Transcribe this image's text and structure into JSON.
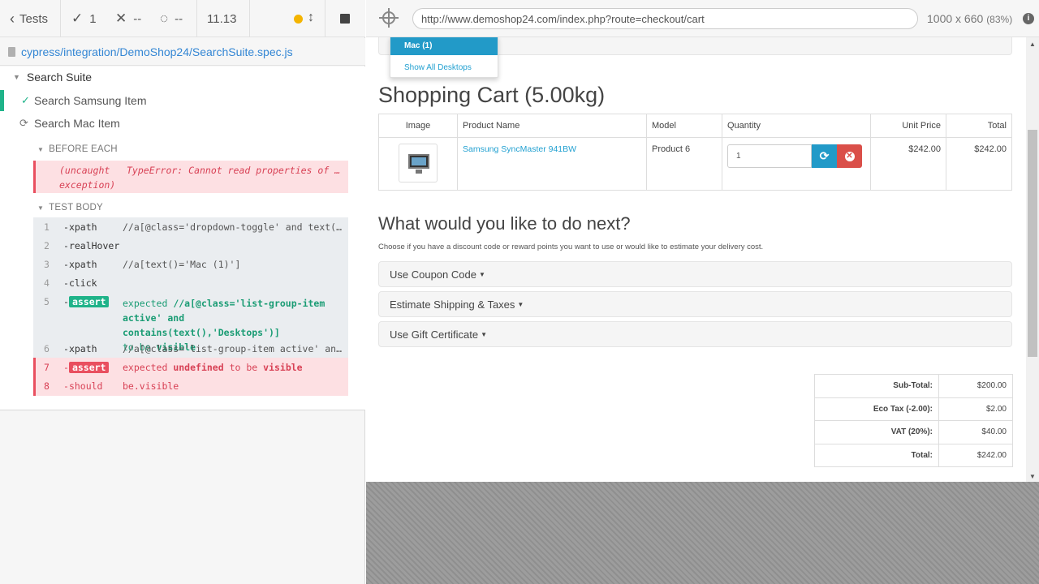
{
  "reporter": {
    "tests_label": "Tests",
    "passed_count": "1",
    "failed_count": "--",
    "pending_count": "--",
    "duration": "11.13",
    "spec_path": "cypress/integration/DemoShop24/SearchSuite.spec.js",
    "suite_title": "Search Suite",
    "tests": [
      {
        "title": "Search Samsung Item",
        "state": "passed"
      },
      {
        "title": "Search Mac Item",
        "state": "running"
      }
    ],
    "before_each_label": "BEFORE EACH",
    "error_kind": "(uncaught exception)",
    "error_kind_l1": "(uncaught",
    "error_kind_l2": "exception)",
    "error_message": "TypeError: Cannot read properties of un…",
    "test_body_label": "TEST BODY",
    "commands": [
      {
        "num": "1",
        "name": "xpath",
        "message": "//a[@class='dropdown-toggle' and text()=…"
      },
      {
        "num": "2",
        "name": "realHover",
        "message": ""
      },
      {
        "num": "3",
        "name": "xpath",
        "message": "//a[text()='Mac (1)']"
      },
      {
        "num": "4",
        "name": "click",
        "message": ""
      },
      {
        "num": "5",
        "name": "assert",
        "message_parts": [
          "expected",
          "//a[@class='list-group-item",
          "active' and contains(text(),'Desktops')]",
          "to be",
          "visible"
        ]
      },
      {
        "num": "6",
        "name": "xpath",
        "message": "//a[@class='list-group-item active' and …"
      },
      {
        "num": "7",
        "name": "assert",
        "message_parts": [
          "expected",
          "undefined",
          "to be",
          "visible"
        ]
      },
      {
        "num": "8",
        "name": "should",
        "message": "be.visible"
      }
    ]
  },
  "aut": {
    "url": "http://www.demoshop24.com/index.php?route=checkout/cart",
    "viewport": "1000 x 660",
    "scale": "(83%)",
    "dropdown": {
      "active_item": "Mac (1)",
      "show_all": "Show All Desktops"
    },
    "heading": "Shopping Cart  (5.00kg)",
    "cart_headers": [
      "Image",
      "Product Name",
      "Model",
      "Quantity",
      "Unit Price",
      "Total"
    ],
    "cart_row": {
      "product_name": "Samsung SyncMaster 941BW",
      "model": "Product 6",
      "quantity": "1",
      "unit_price": "$242.00",
      "total": "$242.00"
    },
    "next_heading": "What would you like to do next?",
    "next_description": "Choose if you have a discount code or reward points you want to use or would like to estimate your delivery cost.",
    "panels": [
      "Use Coupon Code",
      "Estimate Shipping & Taxes",
      "Use Gift Certificate"
    ],
    "totals": [
      {
        "label": "Sub-Total:",
        "value": "$200.00"
      },
      {
        "label": "Eco Tax (-2.00):",
        "value": "$2.00"
      },
      {
        "label": "VAT (20%):",
        "value": "$40.00"
      },
      {
        "label": "Total:",
        "value": "$242.00"
      }
    ]
  },
  "colors": {
    "passed": "#1fb389",
    "failed": "#e94f5f",
    "link": "#3386d4",
    "brand_blue": "#229ac8",
    "danger": "#da4f49"
  }
}
